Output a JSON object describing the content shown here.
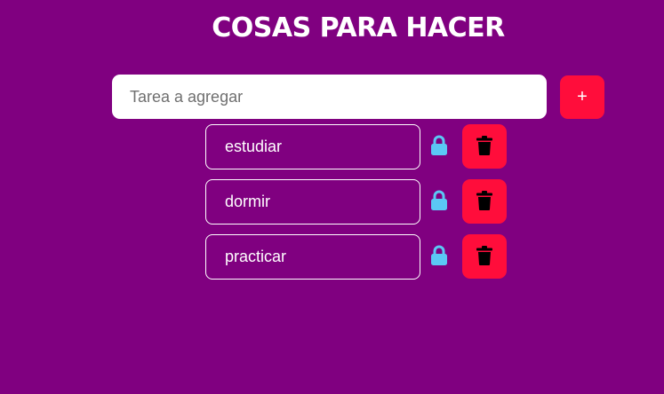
{
  "header": {
    "title": "COSAS PARA HACER"
  },
  "new_task": {
    "placeholder": "Tarea a agregar",
    "value": "",
    "add_label": "+"
  },
  "tasks": [
    {
      "label": "estudiar",
      "lock_icon": "lock-icon",
      "delete_icon": "trash-icon"
    },
    {
      "label": "dormir",
      "lock_icon": "lock-icon",
      "delete_icon": "trash-icon"
    },
    {
      "label": "practicar",
      "lock_icon": "lock-icon",
      "delete_icon": "trash-icon"
    }
  ],
  "colors": {
    "background": "#800080",
    "accent": "#ff0d3b",
    "lock": "#5bc8f5",
    "trash": "#000000",
    "text": "#ffffff"
  }
}
